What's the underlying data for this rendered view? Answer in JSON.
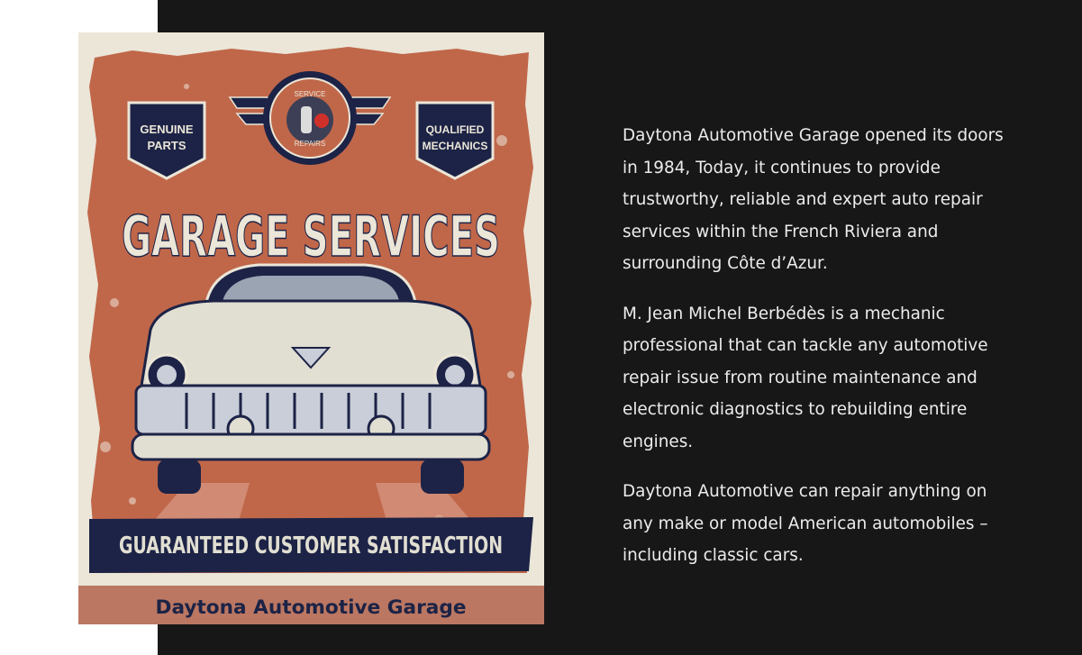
{
  "poster": {
    "badge_left_line1": "GENUINE",
    "badge_left_line2": "PARTS",
    "badge_right_line1": "QUALIFIED",
    "badge_right_line2": "MECHANICS",
    "emblem_top": "SERVICE",
    "emblem_bottom": "REPAIRS",
    "headline": "GARAGE SERVICES",
    "banner": "GUARANTEED CUSTOMER SATISFACTION",
    "footer": "Daytona Automotive Garage"
  },
  "about": {
    "paragraphs": [
      "Daytona Automotive Garage opened its doors in 1984, Today, it continues to provide trustworthy, reliable and expert auto repair services within the French Riviera and surrounding Côte d’Azur.",
      "M. Jean Michel Berbédès is a mechanic professional that can tackle any automotive repair issue from routine maintenance and electronic diagnostics to rebuilding entire engines.",
      "Daytona Automotive can repair anything on any make or model American automobiles – including classic cars."
    ]
  },
  "colors": {
    "background": "#171717",
    "poster_rust": "#c0674a",
    "poster_navy": "#1c2346",
    "poster_cream": "#ebe6d8",
    "text": "#ececec"
  }
}
